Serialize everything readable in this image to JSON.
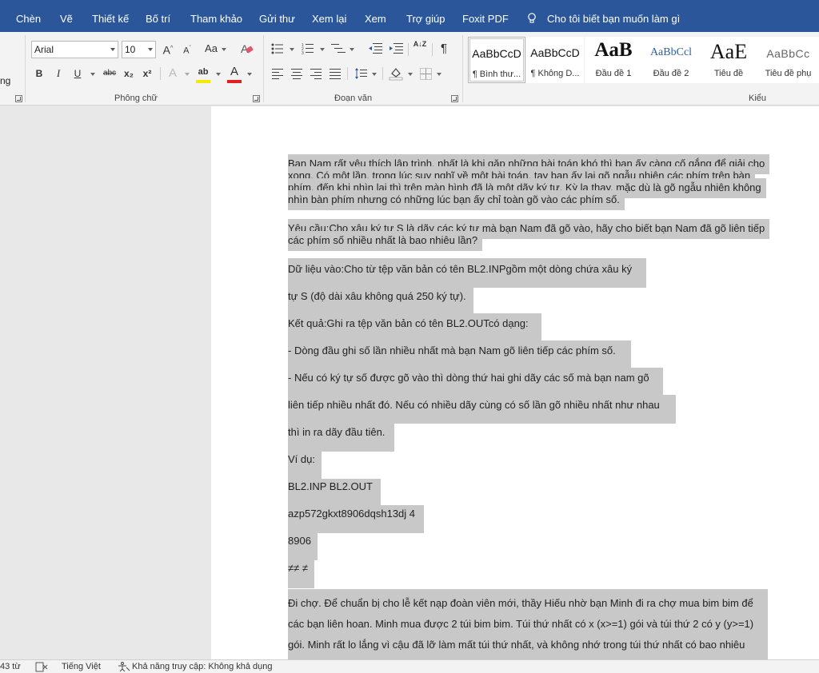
{
  "menu": {
    "tabs": [
      "Chèn",
      "Vẽ",
      "Thiết kế",
      "Bố trí",
      "Tham khảo",
      "Gửi thư",
      "Xem lại",
      "Xem",
      "Trợ giúp",
      "Foxit PDF"
    ],
    "tell_me": "Cho tôi biết bạn muốn làm gì"
  },
  "ribbon": {
    "partial_group_label": "ng",
    "font": {
      "name": "Arial",
      "size": "10",
      "grow_label": "A",
      "shrink_label": "A",
      "case_label": "Aa",
      "bold_label": "B",
      "italic_label": "I",
      "underline_label": "U",
      "strike_label": "abc",
      "subscript_label": "x₂",
      "superscript_label": "x²",
      "effects_label": "A",
      "highlight_label": "ab",
      "fontcolor_label": "A",
      "group_label": "Phông chữ"
    },
    "paragraph": {
      "sort_label": "A↓Z",
      "pilcrow_label": "¶",
      "group_label": "Đoạn văn"
    },
    "styles": {
      "items": [
        {
          "sample": "AaBbCcD",
          "name": "¶ Bình thư..."
        },
        {
          "sample": "AaBbCcD",
          "name": "¶ Không D..."
        },
        {
          "sample": "AaB",
          "name": "Đầu đề 1"
        },
        {
          "sample": "AaBbCcl",
          "name": "Đầu đề 2"
        },
        {
          "sample": "AaE",
          "name": "Tiêu đề"
        },
        {
          "sample": "AaBbCc",
          "name": "Tiêu đề phụ"
        }
      ],
      "group_label": "Kiểu"
    }
  },
  "document": {
    "paragraphs": [
      "Bạn Nam rất yêu thích lập trình, nhất là khi gặp những bài toán khó thì bạn ấy càng cố gắng để giải cho xong. Có một lần, trong lúc suy nghĩ về một bài toán, tay bạn ấy lại gõ ngẫu nhiên các phím trên bàn phím, đến khi nhìn lại thì trên màn hình đã là một dãy ký tự. Kỳ lạ thay, mặc dù là gõ ngẫu nhiên không nhìn bàn phím nhưng có những lúc bạn ấy chỉ toàn gõ vào các phím số.",
      "Yêu cầu:Cho xâu ký tự S là dãy các ký tự mà bạn Nam đã gõ vào, hãy cho biết bạn Nam đã gõ liên tiếp các phím số nhiều nhất là bao nhiêu lần?",
      "Dữ liệu vào:Cho từ tệp văn bản có tên BL2.INPgồm một dòng chứa xâu ký",
      "tự S (độ dài xâu không quá 250 ký tự).",
      "Kết quả:Ghi ra tệp văn bản có tên BL2.OUTcó dạng:",
      "- Dòng đầu ghi số lần nhiều nhất mà bạn Nam gõ liên tiếp các phím số.",
      "- Nếu có ký tự số được gõ vào thì dòng thứ hai ghi dãy các số mà bạn nam gõ",
      "liên tiếp nhiều nhất đó. Nếu có nhiều dãy cùng có số lần gõ nhiều nhất như nhau",
      "thì in ra dãy đầu tiên.",
      "Ví dụ:",
      "BL2.INP BL2.OUT",
      "azp572gkxt8906dqsh13dj 4",
      "8906",
      "≠≠ ≠",
      "Đi chợ. Để chuẩn bị cho lễ kết nạp đoàn viên mới, thầy Hiếu nhờ bạn Minh đi ra chợ mua bim bim để",
      "các bạn liên hoan. Minh mua được 2 túi bim bim. Túi thứ nhất có x (x>=1) gói và túi thứ 2 có y (y>=1)",
      "gói. Minh rất lo lắng vì cậu đã lỡ làm mất túi thứ nhất, và không nhớ trong túi thứ nhất có bao nhiêu"
    ]
  },
  "statusbar": {
    "word_count": "43 từ",
    "language": "Tiếng Việt",
    "accessibility": "Khả năng truy cập: Không khả dụng"
  }
}
